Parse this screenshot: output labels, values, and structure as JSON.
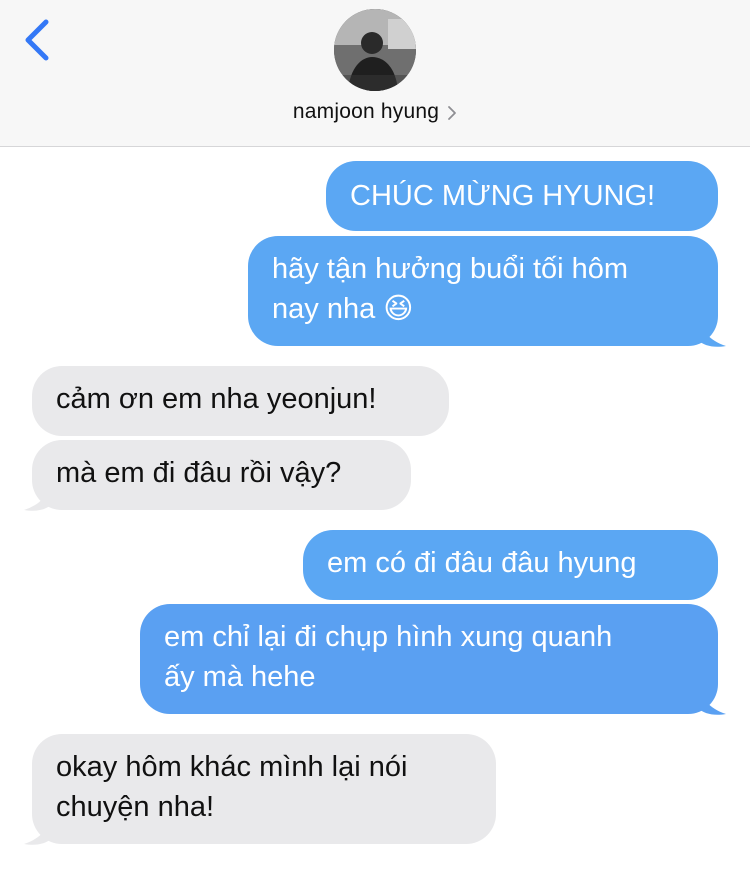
{
  "header": {
    "contact_name": "namjoon hyung",
    "back_icon": "chevron-left-icon",
    "info_icon": "chevron-right-icon"
  },
  "messages": [
    {
      "side": "sent",
      "lines": [
        "CHÚC MỪNG HYUNG!"
      ]
    },
    {
      "side": "sent",
      "lines": [
        "hãy tận hưởng buổi tối hôm",
        "nay nha 😆"
      ]
    },
    {
      "side": "received",
      "lines": [
        "cảm ơn em nha yeonjun!"
      ]
    },
    {
      "side": "received",
      "lines": [
        "mà em đi đâu rồi vậy?"
      ]
    },
    {
      "side": "sent",
      "lines": [
        "em có đi đâu đâu hyung"
      ]
    },
    {
      "side": "sent",
      "lines": [
        "em chỉ lại đi chụp hình xung quanh",
        "ấy mà hehe"
      ]
    },
    {
      "side": "received",
      "lines": [
        "okay hôm khác mình lại nói",
        "chuyện nha!"
      ]
    }
  ],
  "colors": {
    "sent_bubble": "#5ba7f3",
    "received_bubble": "#e9e9eb",
    "accent": "#3478f6",
    "header_bg": "#f7f7f7"
  }
}
